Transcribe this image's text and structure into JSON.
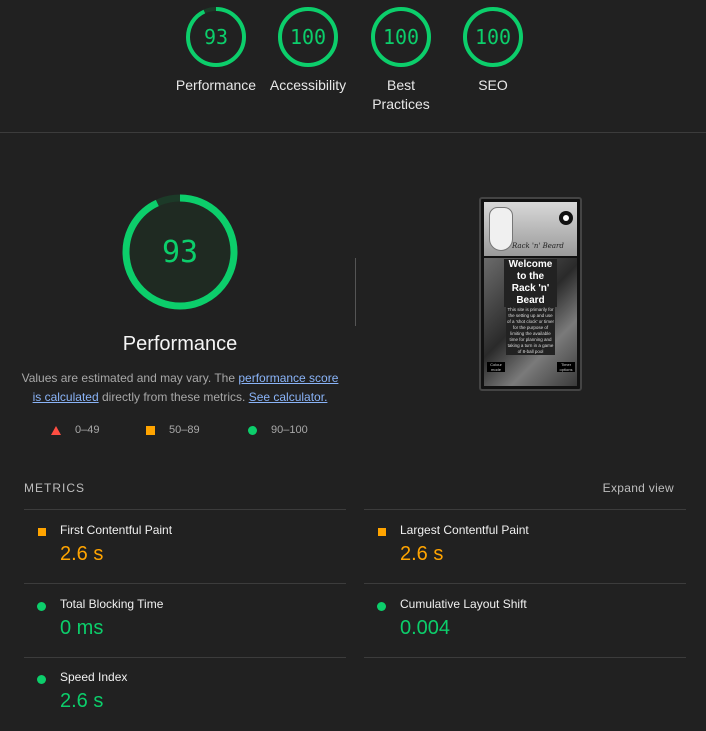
{
  "categories": [
    {
      "score": "93",
      "label": "Performance",
      "fraction": 0.93
    },
    {
      "score": "100",
      "label": "Accessibility",
      "fraction": 1.0
    },
    {
      "score": "100",
      "label": "Best Practices",
      "fraction": 1.0
    },
    {
      "score": "100",
      "label": "SEO",
      "fraction": 1.0
    }
  ],
  "main": {
    "score": "93",
    "fraction": 0.93,
    "title": "Performance",
    "desc_prefix": "Values are estimated and may vary. The ",
    "desc_link1": "performance score is calculated",
    "desc_middle": " directly from these metrics. ",
    "desc_link2": "See calculator."
  },
  "legend": [
    {
      "symbol": "triangle",
      "range": "0–49",
      "color": "#ff4e42"
    },
    {
      "symbol": "square",
      "range": "50–89",
      "color": "#ffa400"
    },
    {
      "symbol": "circle",
      "range": "90–100",
      "color": "#0cce6b"
    }
  ],
  "screenshot": {
    "brand": "Rack 'n' Beard",
    "welcome": "Welcome to the Rack 'n' Beard",
    "body_text": "This site is primarily for the setting up and use of a 'shot clock' or timer for the purpose of limiting the available time for planning and taking a turn in a game of 8-ball pool",
    "btn_left": "Colour mode",
    "btn_right": "Timer options",
    "ball_number": "8"
  },
  "metrics": {
    "header": "METRICS",
    "expand": "Expand view",
    "items": [
      {
        "title": "First Contentful Paint",
        "value": "2.6 s",
        "status": "average"
      },
      {
        "title": "Largest Contentful Paint",
        "value": "2.6 s",
        "status": "average"
      },
      {
        "title": "Total Blocking Time",
        "value": "0 ms",
        "status": "pass"
      },
      {
        "title": "Cumulative Layout Shift",
        "value": "0.004",
        "status": "pass"
      },
      {
        "title": "Speed Index",
        "value": "2.6 s",
        "status": "pass"
      }
    ]
  },
  "colors": {
    "pass": "#0cce6b",
    "average": "#ffa400",
    "fail": "#ff4e42",
    "background": "#212121"
  }
}
